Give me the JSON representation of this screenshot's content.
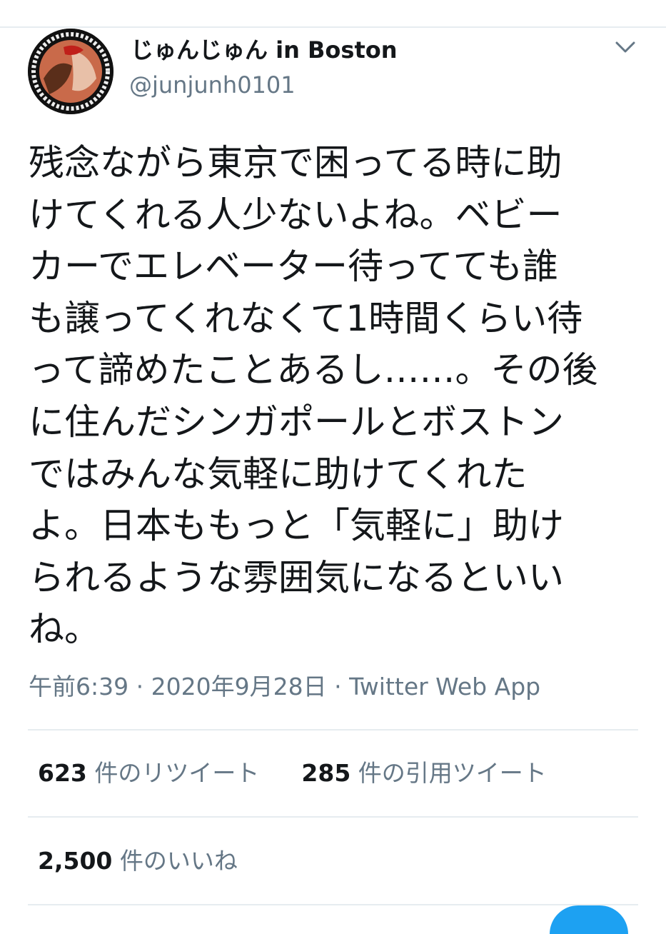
{
  "user": {
    "display_name": "じゅんじゅん in Boston",
    "handle": "@junjunh0101"
  },
  "tweet": {
    "lines": [
      "残念ながら東京で困ってる時に助",
      "けてくれる人少ないよね。ベビー",
      "カーでエレベーター待ってても誰",
      "も譲ってくれなくて1時間くらい待",
      "って諦めたことあるし……。その後",
      "に住んだシンガポールとボストン",
      "ではみんな気軽に助けてくれた",
      "よ。日本ももっと「気軽に」助け",
      "られるような雰囲気になるといい",
      "ね。"
    ],
    "time": "午前6:39",
    "date": "2020年9月28日",
    "separator": "·",
    "source": "Twitter Web App"
  },
  "stats": {
    "retweets_count": "623",
    "retweets_label": "件のリツイート",
    "quotes_count": "285",
    "quotes_label": "件の引用ツイート",
    "likes_count": "2,500",
    "likes_label": "件のいいね"
  },
  "avatar_ring_text": "Black lives matter",
  "icons": {
    "menu": "chevron-down-icon"
  },
  "colors": {
    "text": "#14171a",
    "secondary": "#657786",
    "divider": "#e6ecf0",
    "accent": "#1da1f2"
  }
}
